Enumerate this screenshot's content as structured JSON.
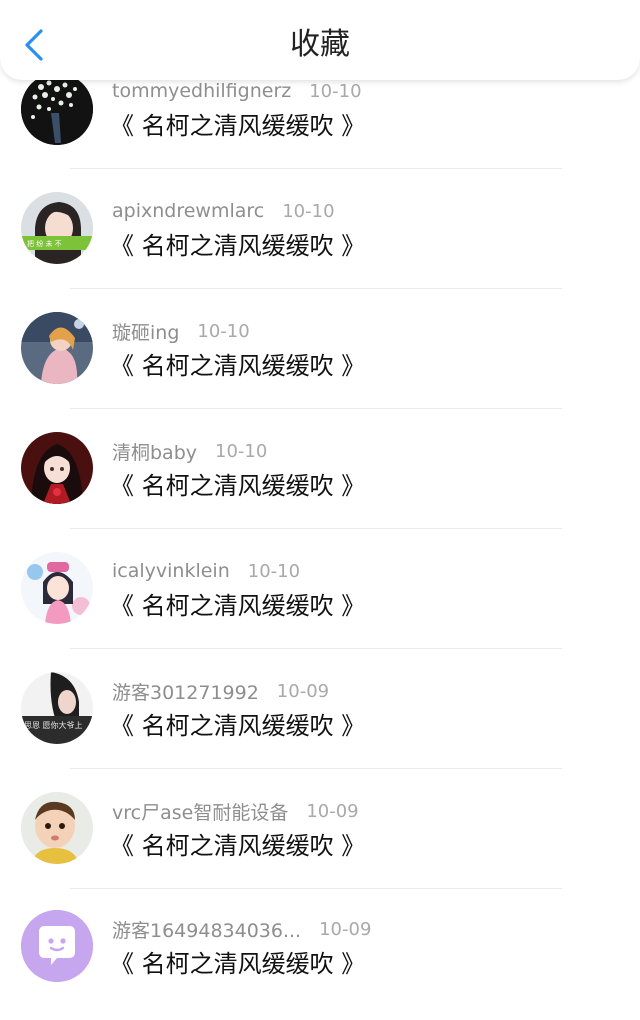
{
  "header": {
    "title": "收藏",
    "back_icon": "chevron-left-icon",
    "accent_color": "#2a8ff2"
  },
  "items": [
    {
      "username": "tommyedhilfignerz",
      "date": "10-10",
      "work": "《 名柯之清风缓缓吹 》",
      "avatar_icon": "flowers-avatar"
    },
    {
      "username": "apixndrewmlarc",
      "date": "10-10",
      "work": "《 名柯之清风缓缓吹 》",
      "avatar_icon": "girl-avatar"
    },
    {
      "username": "璇砸ing",
      "date": "10-10",
      "work": "《 名柯之清风缓缓吹 》",
      "avatar_icon": "photo-avatar"
    },
    {
      "username": "清桐baby",
      "date": "10-10",
      "work": "《 名柯之清风缓缓吹 》",
      "avatar_icon": "anime-avatar"
    },
    {
      "username": "icalyvinklein",
      "date": "10-10",
      "work": "《 名柯之清风缓缓吹 》",
      "avatar_icon": "cartoon-avatar"
    },
    {
      "username": "游客301271992",
      "date": "10-09",
      "work": "《 名柯之清风缓缓吹 》",
      "avatar_icon": "portrait-avatar"
    },
    {
      "username": "vrc尸ase智耐能设备",
      "date": "10-09",
      "work": "《 名柯之清风缓缓吹 》",
      "avatar_icon": "baby-avatar"
    },
    {
      "username": "游客16494834036...",
      "date": "10-09",
      "work": "《 名柯之清风缓缓吹 》",
      "avatar_icon": "chat-bubble-avatar"
    }
  ]
}
